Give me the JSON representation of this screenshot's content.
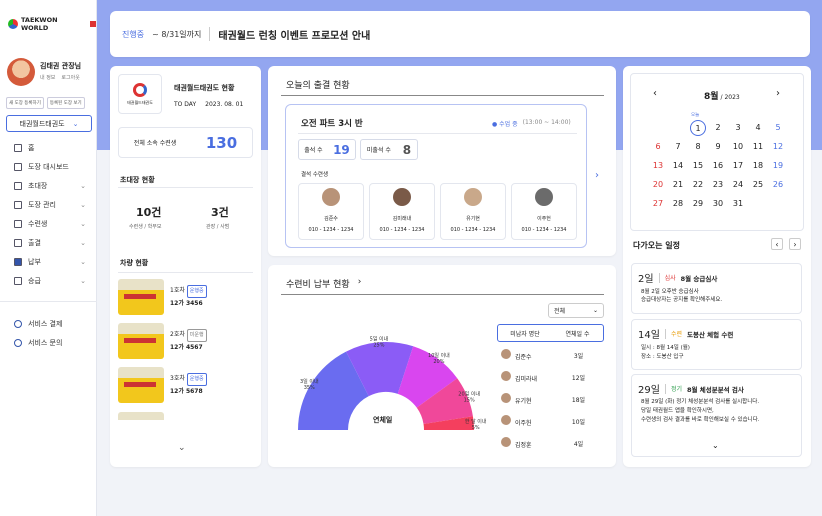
{
  "brand": {
    "name": "TAEKWON WORLD"
  },
  "user": {
    "name": "김태권 관장님",
    "my_info": "내 정보",
    "logout": "로그아웃"
  },
  "sidebar": {
    "buttons": [
      "새 도장 등록하기",
      "등록된 도장 보기"
    ],
    "dojang_select": "태권월드태권도",
    "items": [
      {
        "label": "홈",
        "icon": "home-icon"
      },
      {
        "label": "도장 대시보드",
        "icon": "grid-icon"
      },
      {
        "label": "초대장",
        "icon": "mail-icon"
      },
      {
        "label": "도장 관리",
        "icon": "building-icon"
      },
      {
        "label": "수련생",
        "icon": "people-icon"
      },
      {
        "label": "출결",
        "icon": "calendar-check-icon"
      },
      {
        "label": "납부",
        "icon": "card-icon"
      },
      {
        "label": "승급",
        "icon": "belt-icon"
      }
    ],
    "bottom": [
      {
        "label": "서비스 결제",
        "icon": "gear-icon"
      },
      {
        "label": "서비스 문의",
        "icon": "help-icon"
      }
    ]
  },
  "banner": {
    "status": "진행중",
    "period": "~ 8/31일까지",
    "title": "태권월드 런칭 이벤트 프로모션 안내"
  },
  "dojang": {
    "title": "태권월드태권도 현황",
    "today_label": "TO DAY",
    "date": "2023. 08. 01",
    "logo_caption": "태권월드태권도",
    "total_label": "전체 소속 수련생",
    "total": "130"
  },
  "invite": {
    "title": "초대장 현황",
    "a_value": "10건",
    "a_label": "수련생 / 학부모",
    "b_value": "3건",
    "b_label": "관장 / 사범"
  },
  "vehicles": {
    "title": "차량 현황",
    "items": [
      {
        "no": "1호차",
        "status": "운행중",
        "plate": "12가 3456"
      },
      {
        "no": "2호차",
        "status": "미운행",
        "plate": "12가 4567"
      },
      {
        "no": "3호차",
        "status": "운행중",
        "plate": "12가 5678"
      }
    ]
  },
  "attendance": {
    "title": "오늘의 출결 현황",
    "class_name": "오전 파트 3시 반",
    "class_status": "● 수업 중",
    "class_time": "(13:00 ~ 14:00)",
    "present_label": "출석 수",
    "present": "19",
    "absent_label": "미출석 수",
    "absent": "8",
    "absent_list_label": "결석 수련생",
    "students": [
      {
        "name": "김준수",
        "phone": "010 - 1234 - 1234"
      },
      {
        "name": "김미래내",
        "phone": "010 - 1234 - 1234"
      },
      {
        "name": "유기현",
        "phone": "010 - 1234 - 1234"
      },
      {
        "name": "이주헌",
        "phone": "010 - 1234 - 1234"
      }
    ]
  },
  "payment": {
    "title": "수련비 납부 현황",
    "filter": "전체",
    "center_label": "연체일",
    "chart_data": {
      "type": "pie",
      "categories": [
        "3일 이내",
        "5일 이내",
        "10일 이내",
        "20일 이내",
        "한 달 이내"
      ],
      "values": [
        35,
        25,
        20,
        15,
        5
      ],
      "colors": [
        "#6a6cf0",
        "#8b5cf6",
        "#d946ef",
        "#f0489a",
        "#f43f5e"
      ]
    },
    "table_headers": [
      "미납자 명단",
      "연체일 수"
    ],
    "rows": [
      {
        "name": "김준수",
        "days": "3일"
      },
      {
        "name": "김미라내",
        "days": "12일"
      },
      {
        "name": "유기현",
        "days": "18일"
      },
      {
        "name": "이주헌",
        "days": "10일"
      },
      {
        "name": "김정훈",
        "days": "4일"
      }
    ]
  },
  "calendar": {
    "month": "8월",
    "year": "/ 2023",
    "today_label": "오늘",
    "weeks": [
      [
        "",
        "",
        "1",
        "2",
        "3",
        "4",
        "5"
      ],
      [
        "6",
        "7",
        "8",
        "9",
        "10",
        "11",
        "12"
      ],
      [
        "13",
        "14",
        "15",
        "16",
        "17",
        "18",
        "19"
      ],
      [
        "20",
        "21",
        "22",
        "23",
        "24",
        "25",
        "26"
      ],
      [
        "27",
        "28",
        "29",
        "30",
        "31",
        "",
        ""
      ]
    ]
  },
  "schedule": {
    "title": "다가오는 일정",
    "events": [
      {
        "day": "2일",
        "type": "심사",
        "title": "8월 승급심사",
        "desc": "8월 2일 오후반 승급심사\n승급대상자는 공지를 확인해주세요."
      },
      {
        "day": "14일",
        "type": "수련",
        "title": "도봉산 체험 수련",
        "desc": "일시 : 8월 14일 (월)\n장소 : 도봉산 입구"
      },
      {
        "day": "29일",
        "type": "정기",
        "title": "8월 체성분분석 검사",
        "desc": "8월 29일 (화) 정기 체성분분석 검사를 실시합니다.\n당일 태권월드 앱을 확인하시면,\n수련생의 검사 결과를 바로 확인해보실 수 있습니다."
      }
    ]
  }
}
